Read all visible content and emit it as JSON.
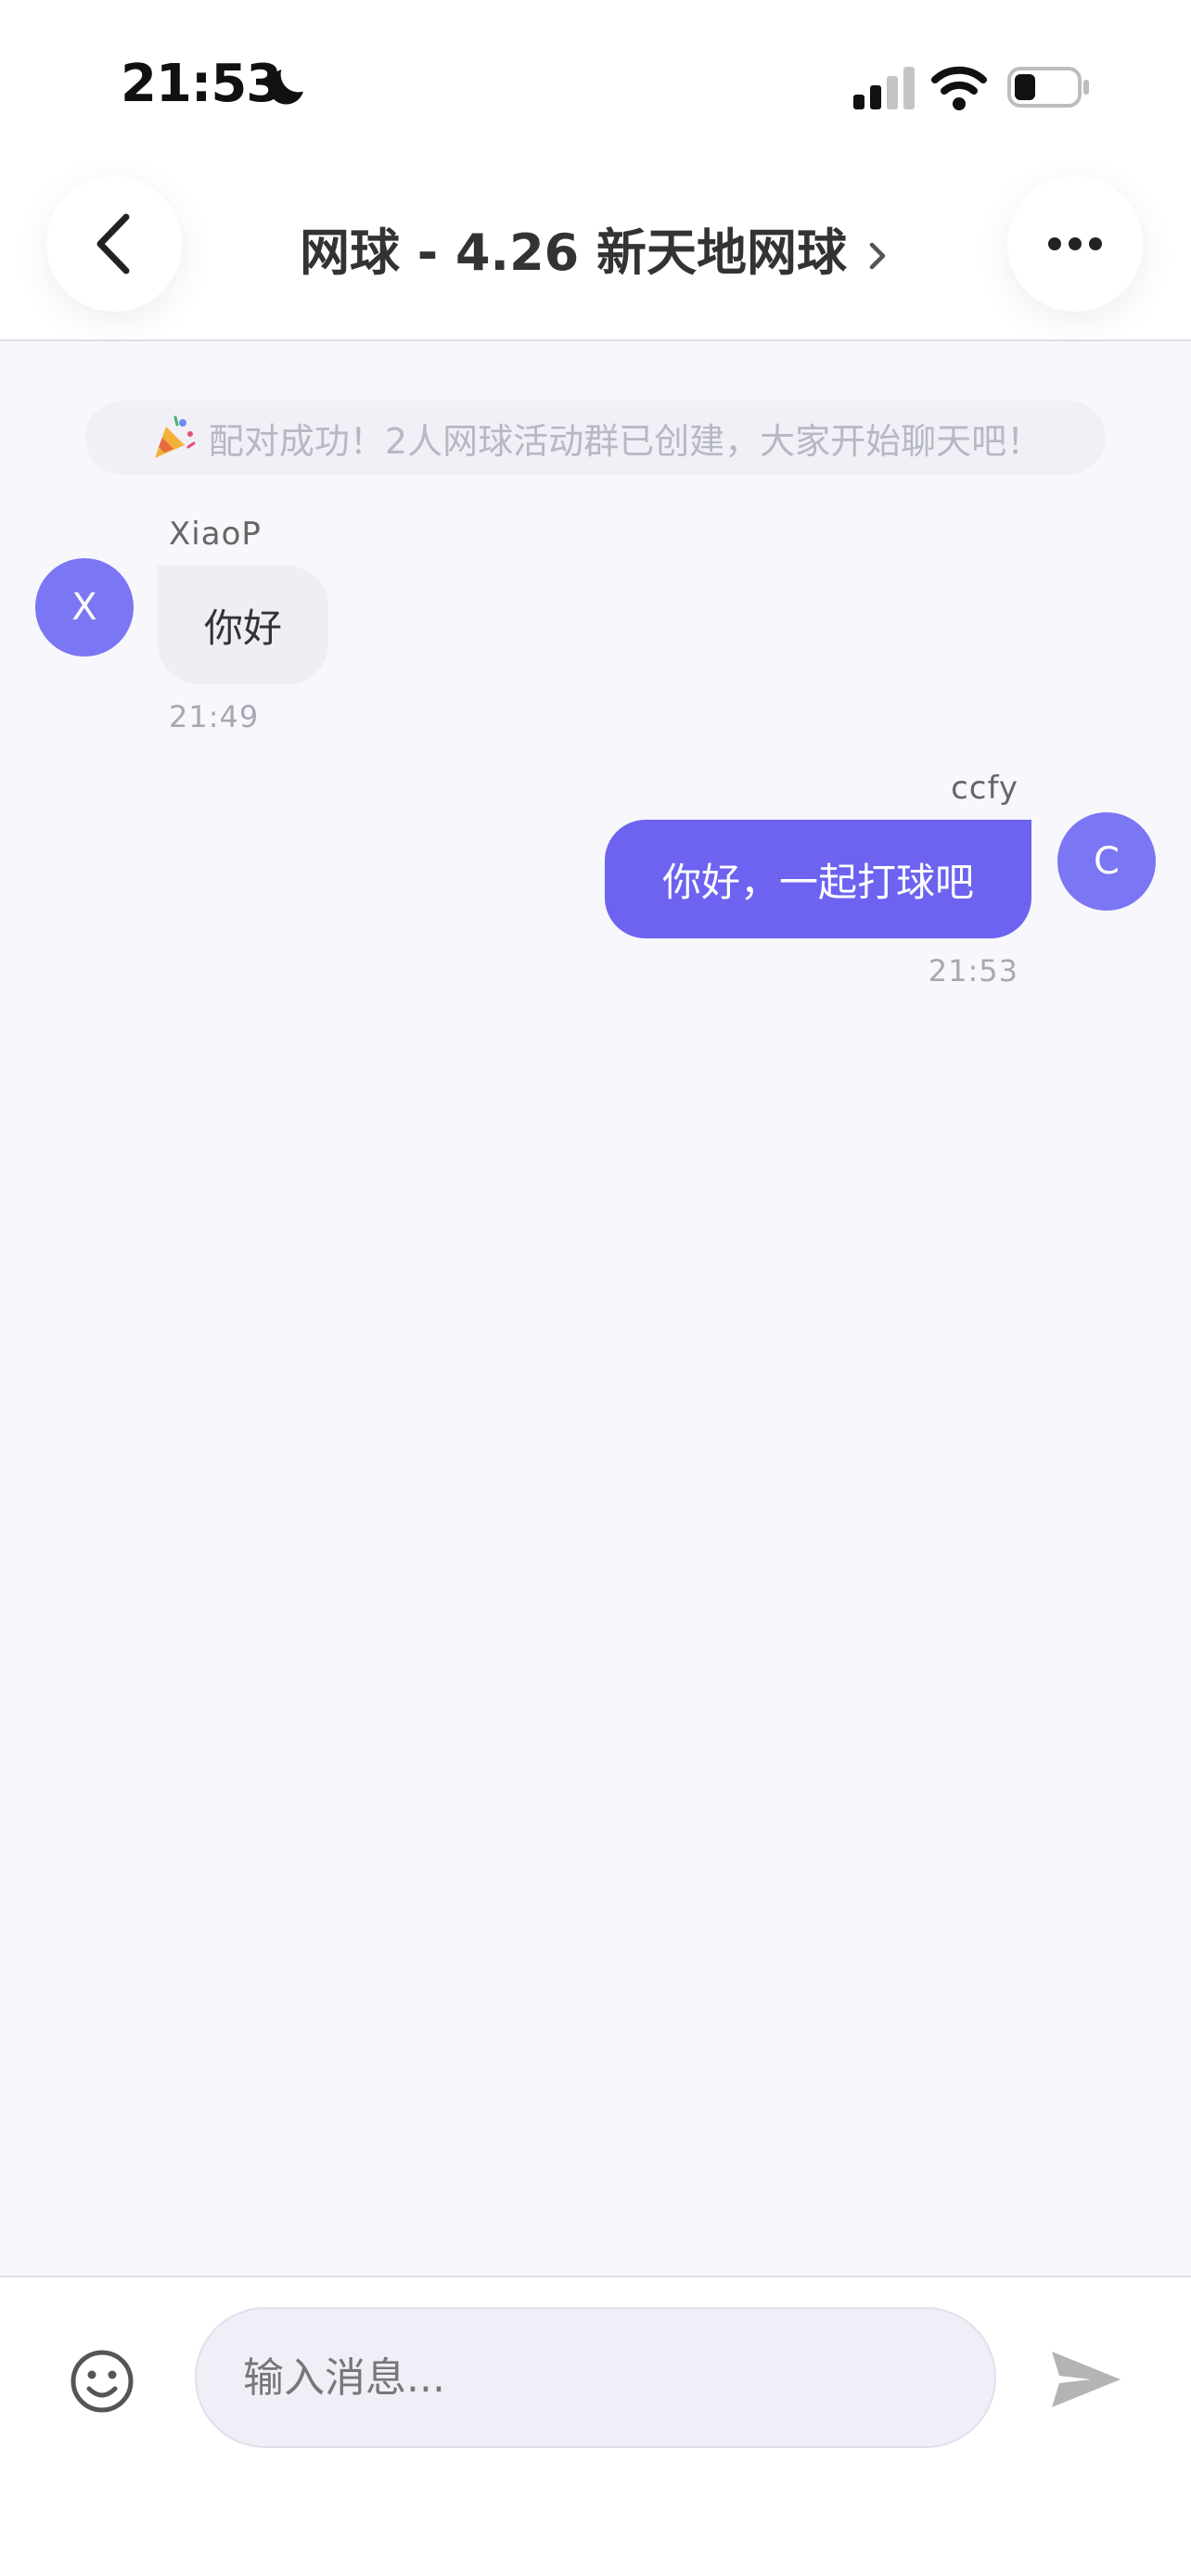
{
  "status_bar": {
    "time": "21:53"
  },
  "header": {
    "title": "网球 - 4.26 新天地网球"
  },
  "system_notice": "配对成功！2人网球活动群已创建，大家开始聊天吧！",
  "messages": [
    {
      "sender": "XiaoP",
      "avatar_letter": "X",
      "text": "你好",
      "time": "21:49",
      "direction": "incoming"
    },
    {
      "sender": "ccfy",
      "avatar_letter": "C",
      "text": "你好，一起打球吧",
      "time": "21:53",
      "direction": "outgoing"
    }
  ],
  "composer": {
    "placeholder": "输入消息..."
  },
  "icons": {
    "back": "chevron-left-icon",
    "more": "ellipsis-icon",
    "emoji": "smiley-icon",
    "send": "paper-plane-icon",
    "notice": "party-popper-icon"
  },
  "colors": {
    "accent": "#6d63f0",
    "avatar": "#7b76f3",
    "incoming_bubble": "#eeeef5",
    "background": "#f7f7fc"
  }
}
